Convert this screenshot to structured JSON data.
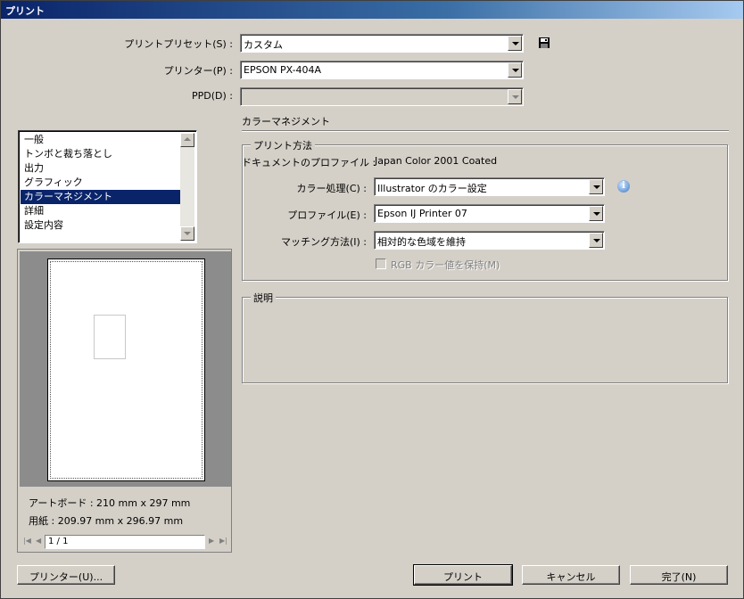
{
  "window": {
    "title": "プリント"
  },
  "top": {
    "preset_label": "プリントプリセット(S) :",
    "preset_value": "カスタム",
    "printer_label": "プリンター(P) :",
    "printer_value": "EPSON PX-404A",
    "ppd_label": "PPD(D) :",
    "ppd_value": ""
  },
  "section": {
    "title": "カラーマネジメント"
  },
  "sidebar": {
    "items": [
      {
        "label": "一般"
      },
      {
        "label": "トンボと裁ち落とし"
      },
      {
        "label": "出力"
      },
      {
        "label": "グラフィック"
      },
      {
        "label": "カラーマネジメント",
        "selected": true
      },
      {
        "label": "詳細"
      },
      {
        "label": "設定内容"
      }
    ]
  },
  "print_method": {
    "group_title": "プリント方法",
    "doc_profile_label": "ドキュメントのプロファイル :",
    "doc_profile_value": "Japan Color 2001 Coated",
    "color_handling_label": "カラー処理(C) :",
    "color_handling_value": "Illustrator のカラー設定",
    "profile_label": "プロファイル(E) :",
    "profile_value": "Epson IJ Printer 07",
    "intent_label": "マッチング方法(I) :",
    "intent_value": "相対的な色域を維持",
    "preserve_rgb_label": "RGB カラー値を保持(M)"
  },
  "description": {
    "group_title": "説明"
  },
  "preview": {
    "artboard_text": "アートボード : 210 mm x 297 mm",
    "paper_text": "用紙 : 209.97 mm x 296.97 mm",
    "page_value": "1 / 1"
  },
  "buttons": {
    "printer_setup": "プリンター(U)...",
    "print": "プリント",
    "cancel": "キャンセル",
    "done": "完了(N)"
  }
}
